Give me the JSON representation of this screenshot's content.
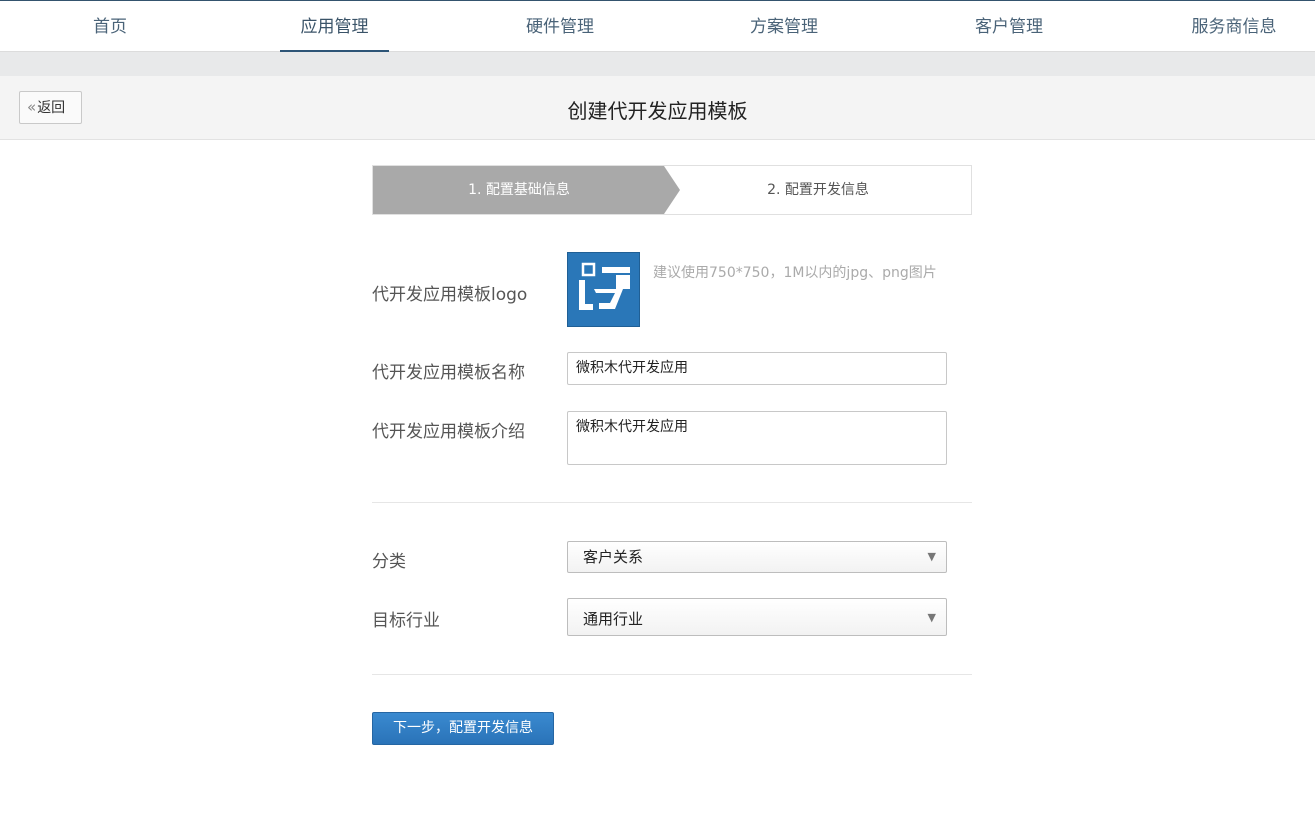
{
  "nav": {
    "items": [
      {
        "label": "首页"
      },
      {
        "label": "应用管理"
      },
      {
        "label": "硬件管理"
      },
      {
        "label": "方案管理"
      },
      {
        "label": "客户管理"
      },
      {
        "label": "服务商信息"
      }
    ],
    "active_index": 1
  },
  "header": {
    "back_label": "返回",
    "title": "创建代开发应用模板"
  },
  "steps": [
    {
      "label": "1. 配置基础信息",
      "active": true
    },
    {
      "label": "2. 配置开发信息",
      "active": false
    }
  ],
  "form": {
    "logo": {
      "label": "代开发应用模板logo",
      "hint": "建议使用750*750，1M以内的jpg、png图片",
      "icon": "app-logo-icon",
      "bg_color": "#2a77b8"
    },
    "name": {
      "label": "代开发应用模板名称",
      "value": "微积木代开发应用"
    },
    "intro": {
      "label": "代开发应用模板介绍",
      "value": "微积木代开发应用"
    },
    "category": {
      "label": "分类",
      "selected": "客户关系"
    },
    "industry": {
      "label": "目标行业",
      "selected": "通用行业"
    },
    "next_button": "下一步，配置开发信息"
  },
  "colors": {
    "accent": "#2a73b8",
    "nav_underline": "#2d5577",
    "step_active": "#a9a9a9"
  }
}
